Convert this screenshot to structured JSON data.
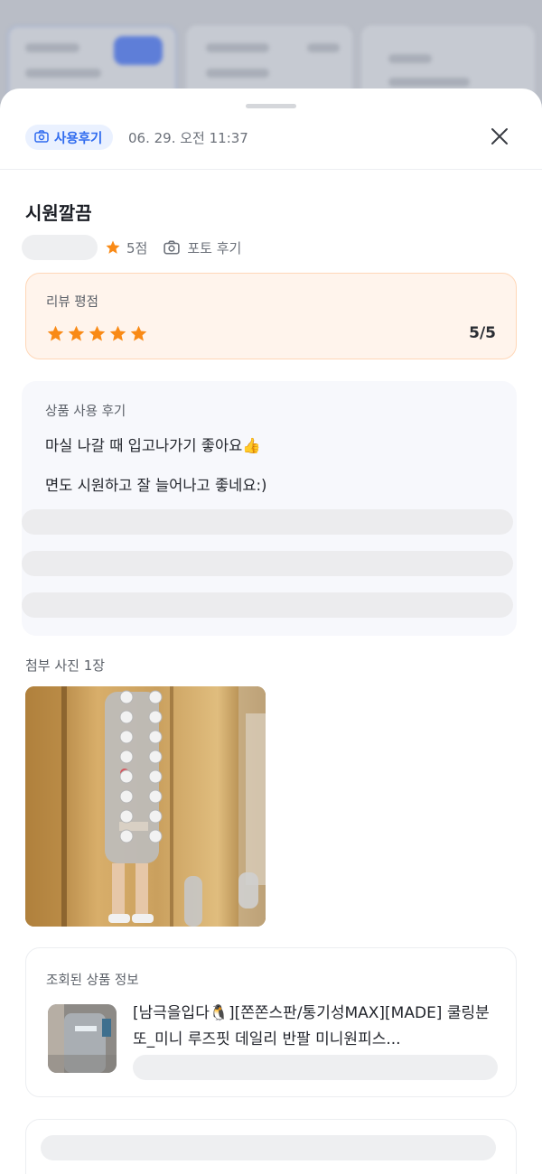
{
  "header": {
    "badge_label": "사용후기",
    "timestamp": "06. 29. 오전 11:37"
  },
  "review": {
    "title": "시원깔끔",
    "rating_label": "5점",
    "photo_review_label": "포토 후기"
  },
  "rating_card": {
    "title": "리뷰 평점",
    "score": "5/5",
    "stars_filled": 5,
    "stars_total": 5
  },
  "usage_card": {
    "title": "상품 사용 후기",
    "lines": [
      "마실 나갈 때 입고나가기 좋아요👍",
      "면도 시원하고 잘 늘어나고 좋네요:)"
    ]
  },
  "attachments": {
    "label": "첨부 사진 1장"
  },
  "product_card": {
    "title": "조회된 상품 정보",
    "name": "[남극을입다🐧][쫀쫀스판/통기성MAX][MADE] 쿨링분또_미니 루즈핏 데일리 반팔 미니원피스..."
  },
  "colors": {
    "accent": "#2f6bef",
    "star": "#f98a16",
    "rating_card_bg": "#fff4ec",
    "rating_card_border": "#ffd7b8"
  },
  "icons": [
    "camera-icon",
    "close-icon",
    "star-icon"
  ]
}
